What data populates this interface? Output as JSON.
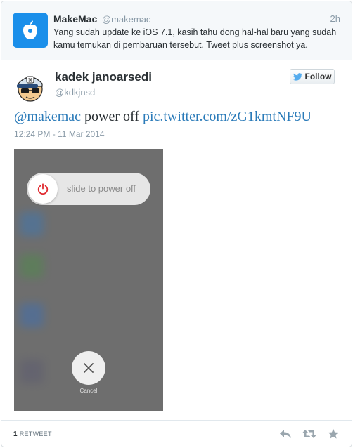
{
  "reply_to": {
    "name": "MakeMac",
    "handle": "@makemac",
    "time": "2h",
    "text": "Yang sudah update ke iOS 7.1, kasih tahu dong hal-hal baru yang sudah kamu temukan di pembaruan tersebut. Tweet plus screenshot ya.",
    "avatar_icon": "apple-logo-icon",
    "avatar_color": "#1a8fea"
  },
  "tweet": {
    "author_name": "kadek janoarsedi",
    "author_handle": "@kdkjnsd",
    "follow_label": "Follow",
    "text_mention": "@makemac",
    "text_body": " power off ",
    "text_link": "pic.twitter.com/zG1kmtNF9U",
    "timestamp": "12:24 PM - 11 Mar 2014",
    "link_color": "#2b7bb9"
  },
  "photo": {
    "slider_label": "slide to power off",
    "cancel_label": "Cancel",
    "power_icon_color": "#e0282e"
  },
  "footer": {
    "retweet_count": "1",
    "retweet_label": "RETWEET",
    "actions": [
      "reply-icon",
      "retweet-icon",
      "favorite-icon"
    ]
  }
}
